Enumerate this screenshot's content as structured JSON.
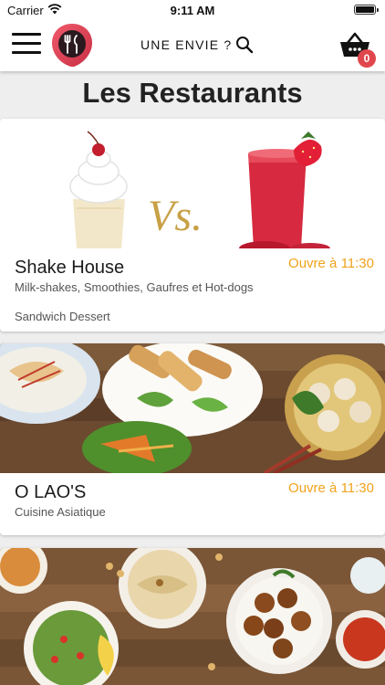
{
  "status_bar": {
    "carrier": "Carrier",
    "time": "9:11 AM"
  },
  "header": {
    "search_label": "UNE ENVIE ?",
    "cart_count": "0",
    "logo_color": "#e0474c"
  },
  "page_title": "Les Restaurants",
  "colors": {
    "accent": "#f0a31c",
    "badge": "#e0474c"
  },
  "restaurants": [
    {
      "name": "Shake House",
      "hours": "Ouvre à 11:30",
      "description": "Milk-shakes, Smoothies, Gaufres et Hot-dogs",
      "tags": "Sandwich Dessert",
      "image_text": "Vs."
    },
    {
      "name": "O LAO'S",
      "hours": "Ouvre à 11:30",
      "description": "Cuisine Asiatique"
    },
    {
      "name": "",
      "hours": "",
      "description": ""
    }
  ]
}
